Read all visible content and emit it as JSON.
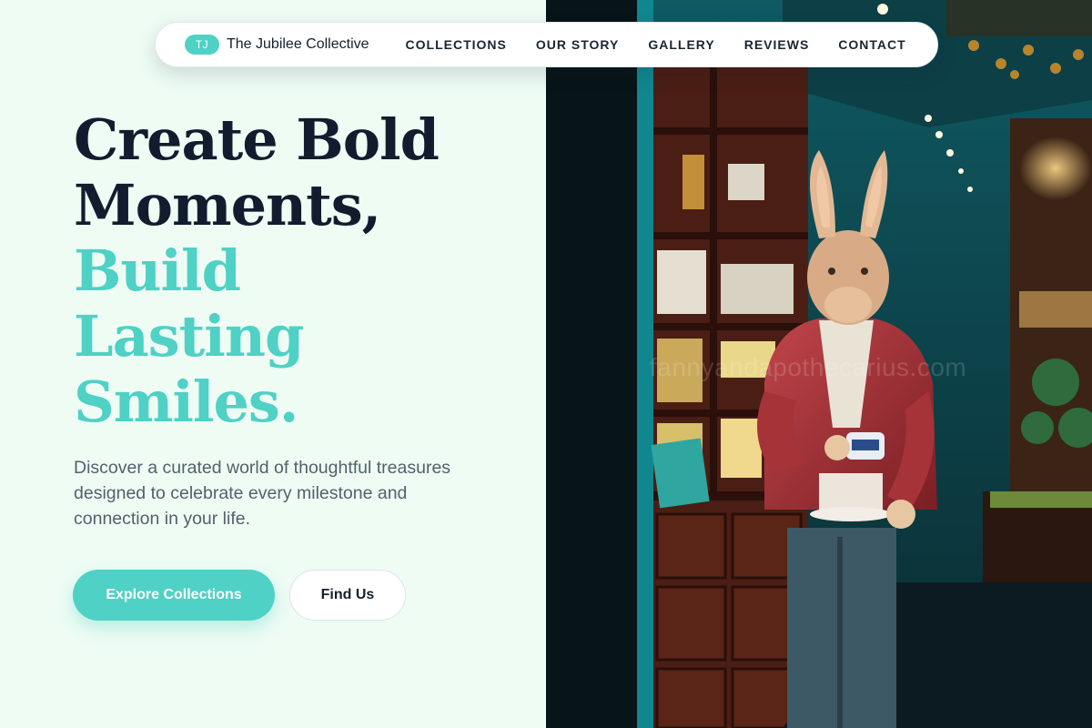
{
  "nav": {
    "logo_badge": "TJ",
    "brand": "The Jubilee Collective",
    "links": [
      "COLLECTIONS",
      "OUR STORY",
      "GALLERY",
      "REVIEWS",
      "CONTACT"
    ]
  },
  "hero": {
    "headline_line1": "Create Bold",
    "headline_line2": "Moments,",
    "headline_line3": "Build",
    "headline_line4": "Lasting",
    "headline_line5": "Smiles.",
    "description": "Discover a curated world of thoughtful treasures designed to celebrate every milestone and connection in your life.",
    "primary_button": "Explore Collections",
    "secondary_button": "Find Us"
  },
  "image": {
    "watermark": "fannyandapothecarius.com"
  },
  "colors": {
    "accent": "#4fd1c5",
    "headline": "#121c2e",
    "background": "#eefcf4"
  }
}
